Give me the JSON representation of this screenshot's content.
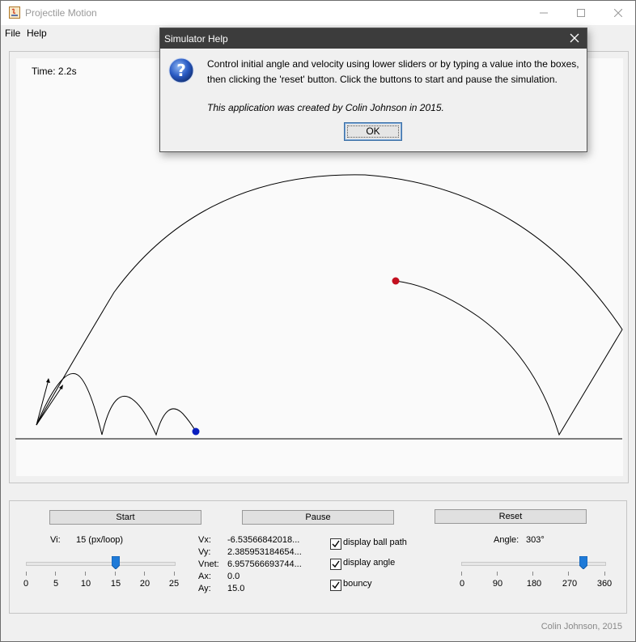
{
  "window": {
    "title": "Projectile Motion"
  },
  "menu": {
    "items": [
      "File",
      "Help"
    ]
  },
  "simulation": {
    "time_label": "Time: 2.2s",
    "colors": {
      "ball_blue": "#0a1fbf",
      "ball_red": "#c3101f",
      "path": "#000000"
    }
  },
  "controls": {
    "start_label": "Start",
    "pause_label": "Pause",
    "reset_label": "Reset",
    "vi_label": "Vi:",
    "vi_value": "15 (px/loop)",
    "vi_slider": {
      "min": 0,
      "max": 25,
      "value": 15,
      "ticks": [
        "0",
        "5",
        "10",
        "15",
        "20",
        "25"
      ]
    },
    "angle_label": "Angle:",
    "angle_value": "303°",
    "angle_slider": {
      "min": 0,
      "max": 360,
      "value": 303,
      "ticks": [
        "0",
        "90",
        "180",
        "270",
        "360"
      ]
    },
    "readouts": [
      {
        "label": "Vx:",
        "value": "-6.53566842018..."
      },
      {
        "label": "Vy:",
        "value": "2.385953184654..."
      },
      {
        "label": "Vnet:",
        "value": "6.957566693744..."
      },
      {
        "label": "Ax:",
        "value": "0.0"
      },
      {
        "label": "Ay:",
        "value": "15.0"
      }
    ],
    "checkboxes": [
      {
        "label": "display ball path",
        "checked": true
      },
      {
        "label": "display angle",
        "checked": true
      },
      {
        "label": "bouncy",
        "checked": true
      }
    ]
  },
  "footer": "Colin Johnson, 2015",
  "dialog": {
    "title": "Simulator Help",
    "line1": "Control initial angle and velocity using lower sliders or by typing a value into the boxes,",
    "line2": "then clicking the 'reset' button. Click the buttons to start and pause the simulation.",
    "credit": "This application was created by Colin Johnson in 2015.",
    "ok_label": "OK"
  }
}
